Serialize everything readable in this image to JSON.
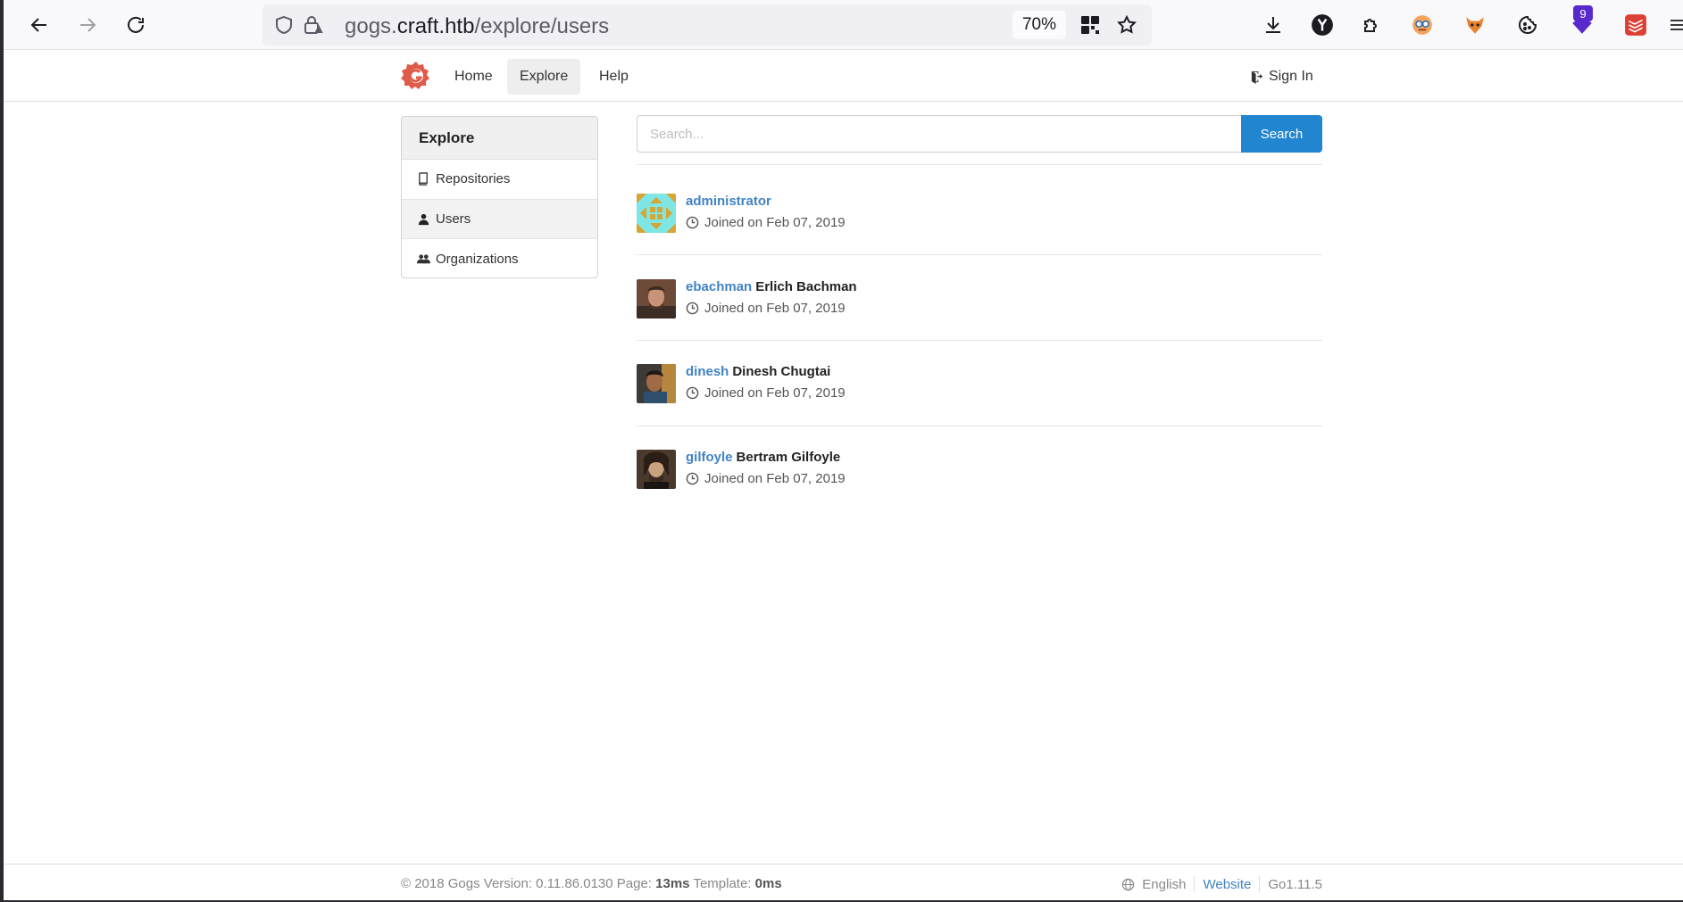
{
  "browser": {
    "url_scheme_host_prefix": "gogs.",
    "url_host": "craft.htb",
    "url_path": "/explore/users",
    "zoom": "70%",
    "ext_badge_count": "9"
  },
  "header": {
    "nav": [
      "Home",
      "Explore",
      "Help"
    ],
    "sign_in": "Sign In"
  },
  "sidebar": {
    "title": "Explore",
    "items": [
      {
        "label": "Repositories",
        "icon": "book-icon"
      },
      {
        "label": "Users",
        "icon": "person-icon",
        "active": true
      },
      {
        "label": "Organizations",
        "icon": "organization-icon"
      }
    ]
  },
  "search": {
    "placeholder": "Search...",
    "button": "Search"
  },
  "users": [
    {
      "username": "administrator",
      "full_name": "",
      "joined": "Joined on Feb 07, 2019"
    },
    {
      "username": "ebachman",
      "full_name": "Erlich Bachman",
      "joined": "Joined on Feb 07, 2019"
    },
    {
      "username": "dinesh",
      "full_name": "Dinesh Chugtai",
      "joined": "Joined on Feb 07, 2019"
    },
    {
      "username": "gilfoyle",
      "full_name": "Bertram Gilfoyle",
      "joined": "Joined on Feb 07, 2019"
    }
  ],
  "footer": {
    "copyright": "© 2018 Gogs Version: 0.11.86.0130 Page:",
    "page_time": "13ms",
    "template_label": "Template:",
    "template_time": "0ms",
    "language": "English",
    "website": "Website",
    "go_version": "Go1.11.5"
  },
  "colors": {
    "accent": "#2185d0",
    "link": "#4183c4",
    "logo": "#e05a48"
  }
}
